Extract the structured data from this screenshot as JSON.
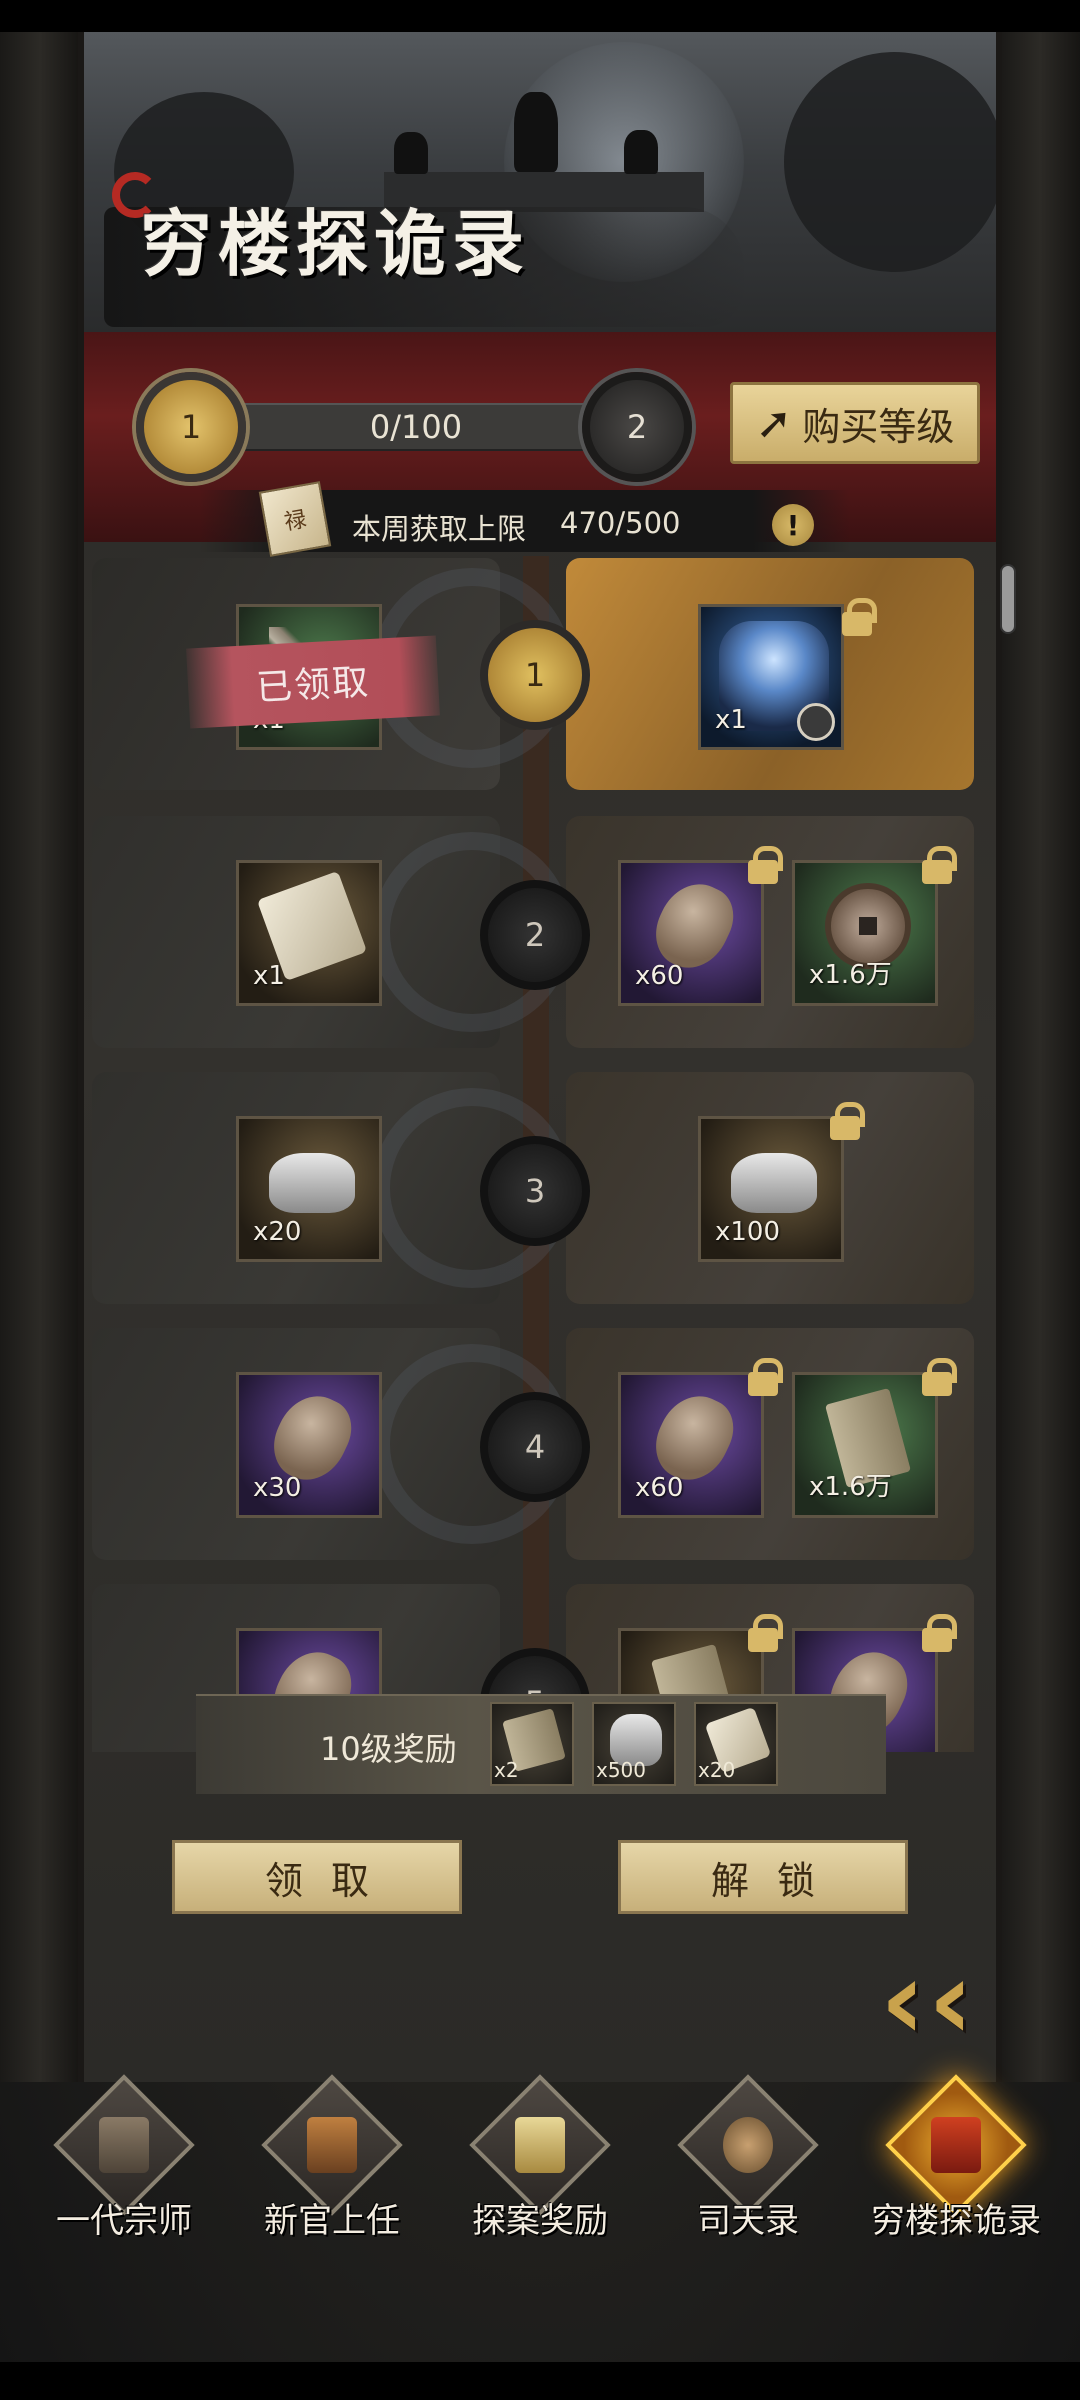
{
  "header": {
    "title": "穷楼探诡录"
  },
  "level": {
    "current": "1",
    "next": "2",
    "progress_text": "0/100",
    "progress_fraction": 0.0,
    "buy_label": "购买等级"
  },
  "weekly": {
    "label": "本周获取上限",
    "value": "470/500",
    "scroll_glyph": "禄"
  },
  "rewards": [
    {
      "level": "1",
      "free": [
        {
          "qty": "x1",
          "icon": "weapon",
          "claimed": true
        }
      ],
      "paid": [
        {
          "qty": "x1",
          "icon": "hero-portrait"
        }
      ]
    },
    {
      "level": "2",
      "free": [
        {
          "qty": "x1",
          "icon": "scroll"
        }
      ],
      "paid": [
        {
          "qty": "x60",
          "icon": "stone"
        },
        {
          "qty": "x1.6万",
          "icon": "copper-coin"
        }
      ]
    },
    {
      "level": "3",
      "free": [
        {
          "qty": "x20",
          "icon": "silver-ingot"
        }
      ],
      "paid": [
        {
          "qty": "x100",
          "icon": "silver-ingot"
        }
      ]
    },
    {
      "level": "4",
      "free": [
        {
          "qty": "x30",
          "icon": "stone"
        }
      ],
      "paid": [
        {
          "qty": "x60",
          "icon": "stone"
        },
        {
          "qty": "x1.6万",
          "icon": "book"
        }
      ]
    },
    {
      "level": "5"
    }
  ],
  "claimed_label": "已领取",
  "level10": {
    "label": "10级奖励",
    "items": [
      {
        "qty": "x2"
      },
      {
        "qty": "x500"
      },
      {
        "qty": "x20"
      }
    ]
  },
  "actions": {
    "claim": "领取",
    "unlock": "解锁"
  },
  "nav": [
    {
      "label": "一代宗师"
    },
    {
      "label": "新官上任"
    },
    {
      "label": "探案奖励"
    },
    {
      "label": "司天录"
    },
    {
      "label": "穷楼探诡录",
      "active": true
    }
  ],
  "colors": {
    "accent_gold": "#c9a54c",
    "claimed_red": "#b5545e",
    "banner_red": "#6a1e1e"
  }
}
